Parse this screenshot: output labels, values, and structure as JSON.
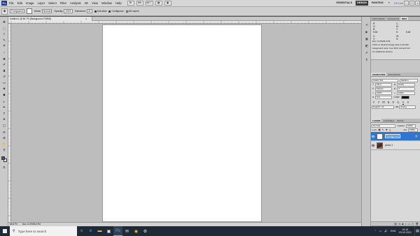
{
  "app": {
    "logo": "Ps",
    "menu": [
      "File",
      "Edit",
      "Image",
      "Layer",
      "Select",
      "Filter",
      "Analysis",
      "3D",
      "View",
      "Window",
      "Help"
    ],
    "zoom_control": "66.7",
    "workspaces": [
      "ESSENTIALS",
      "DESIGN",
      "PAINTING"
    ],
    "active_workspace": "DESIGN",
    "workspace_more": "»",
    "cs_live": "CS Live",
    "window_controls": [
      "–",
      "□",
      "×"
    ]
  },
  "options": {
    "tool_icon": "brush-tool-icon",
    "fill_source": "Foreground",
    "mode_label": "Mode:",
    "mode_value": "Normal",
    "opacity_label": "Opacity:",
    "opacity_value": "100%",
    "tolerance_label": "Tolerance:",
    "tolerance_value": "32",
    "checkboxes": [
      {
        "label": "Anti-alias",
        "checked": true
      },
      {
        "label": "Contiguous",
        "checked": true
      },
      {
        "label": "All Layers",
        "checked": false
      }
    ]
  },
  "document": {
    "tab_title": "Untitled-1 @ 66.7% (Background, RGB/8)",
    "tab_close": "×",
    "zoom_status": "66.67%",
    "doc_size": "Doc: 6.07M/6.07M",
    "canvas_color": "#ffffff"
  },
  "tools": [
    {
      "name": "move-tool-icon",
      "glyph": "✥"
    },
    {
      "name": "marquee-tool-icon",
      "glyph": "⬚"
    },
    {
      "name": "lasso-tool-icon",
      "glyph": "ℓ"
    },
    {
      "name": "quick-select-tool-icon",
      "glyph": "✎"
    },
    {
      "name": "crop-tool-icon",
      "glyph": "⌗"
    },
    {
      "name": "eyedropper-tool-icon",
      "glyph": "⁄"
    },
    {
      "name": "healing-brush-tool-icon",
      "glyph": "✚"
    },
    {
      "name": "brush-tool-icon",
      "glyph": "✐"
    },
    {
      "name": "clone-stamp-tool-icon",
      "glyph": "♜"
    },
    {
      "name": "history-brush-tool-icon",
      "glyph": "↺"
    },
    {
      "name": "eraser-tool-icon",
      "glyph": "▭"
    },
    {
      "name": "paint-bucket-tool-icon",
      "glyph": "◈"
    },
    {
      "name": "blur-tool-icon",
      "glyph": "◆"
    },
    {
      "name": "dodge-tool-icon",
      "glyph": "◐"
    },
    {
      "name": "pen-tool-icon",
      "glyph": "✒"
    },
    {
      "name": "type-tool-icon",
      "glyph": "T"
    },
    {
      "name": "path-select-tool-icon",
      "glyph": "➤"
    },
    {
      "name": "shape-tool-icon",
      "glyph": "▢"
    },
    {
      "name": "3d-rotate-tool-icon",
      "glyph": "⟳"
    },
    {
      "name": "3d-orbit-tool-icon",
      "glyph": "⊛"
    },
    {
      "name": "hand-tool-icon",
      "glyph": "✋"
    },
    {
      "name": "zoom-tool-icon",
      "glyph": "⚲"
    },
    {
      "name": "quick-mask-icon",
      "glyph": "◘"
    }
  ],
  "dock_icons": [
    "history-icon",
    "actions-icon",
    "swatches-icon",
    "styles-icon",
    "brushes-icon",
    "paragraph-icon"
  ],
  "panels": {
    "info": {
      "tabs": [
        "HISTOGRAM",
        "NAVIGATOR",
        "INFO"
      ],
      "active": "INFO",
      "r_label": "R:",
      "g_label": "G:",
      "b_label": "B:",
      "bits_left": "8-bit",
      "c_label": "C:",
      "m_label": "M:",
      "y_label": "Y:",
      "k_label": "K:",
      "bits_right": "8-bit",
      "x_label": "X:",
      "y2_label": "Y:",
      "w_label": "W:",
      "h_label": "H:",
      "doc_line": "Doc: 6.07M/6.07M",
      "hint1": "Click on desired image area to fill with",
      "hint2": "foreground color.  Use Shift, Alt and Ctrl",
      "hint3": "for additional options."
    },
    "character": {
      "tabs": [
        "CHARACTER",
        "PARAGRAPH"
      ],
      "active": "CHARACTER",
      "font_family": "Arabic Std",
      "font_style": "Medium",
      "font_size": "18 pt",
      "leading": "(Auto)",
      "kerning": "Metrics",
      "tracking": "0",
      "vscale": "100%",
      "hscale": "100%",
      "baseline": "0 pt",
      "color_label": "Color:",
      "styles": [
        "T",
        "T",
        "TT",
        "Tr",
        "T¹",
        "T₁",
        "T",
        "Ŧ"
      ],
      "language": "English: UK",
      "aa_label": "aa",
      "antialias": "Strong"
    },
    "layers": {
      "tabs": [
        "LAYERS",
        "CHANNELS",
        "PATHS"
      ],
      "active": "LAYERS",
      "blend_mode": "Normal",
      "opacity_label": "Opacity:",
      "opacity_value": "100%",
      "lock_label": "Lock:",
      "fill_label": "Fill:",
      "fill_value": "100%",
      "items": [
        {
          "name": "Background",
          "selected": true,
          "thumb": "white",
          "locked": true
        },
        {
          "name": "photo 1",
          "selected": false,
          "thumb": "photo",
          "locked": false
        }
      ],
      "footer_icons": [
        "link-icon",
        "fx-icon",
        "mask-icon",
        "adjustment-icon",
        "folder-icon",
        "new-layer-icon",
        "trash-icon"
      ]
    }
  },
  "taskbar": {
    "search_placeholder": "Type here to search",
    "apps": [
      "task-view-icon",
      "edge-icon",
      "file-explorer-icon",
      "store-icon",
      "photoshop-icon",
      "mail-icon",
      "chrome-icon",
      "settings-icon"
    ],
    "lang": "ENG",
    "time": "15:15",
    "date": "29-02-2021"
  },
  "colors": {
    "foreground": "#0a63c9",
    "background": "#ffffff",
    "selection": "#2f76d1",
    "taskbar": "#1f2a36"
  }
}
